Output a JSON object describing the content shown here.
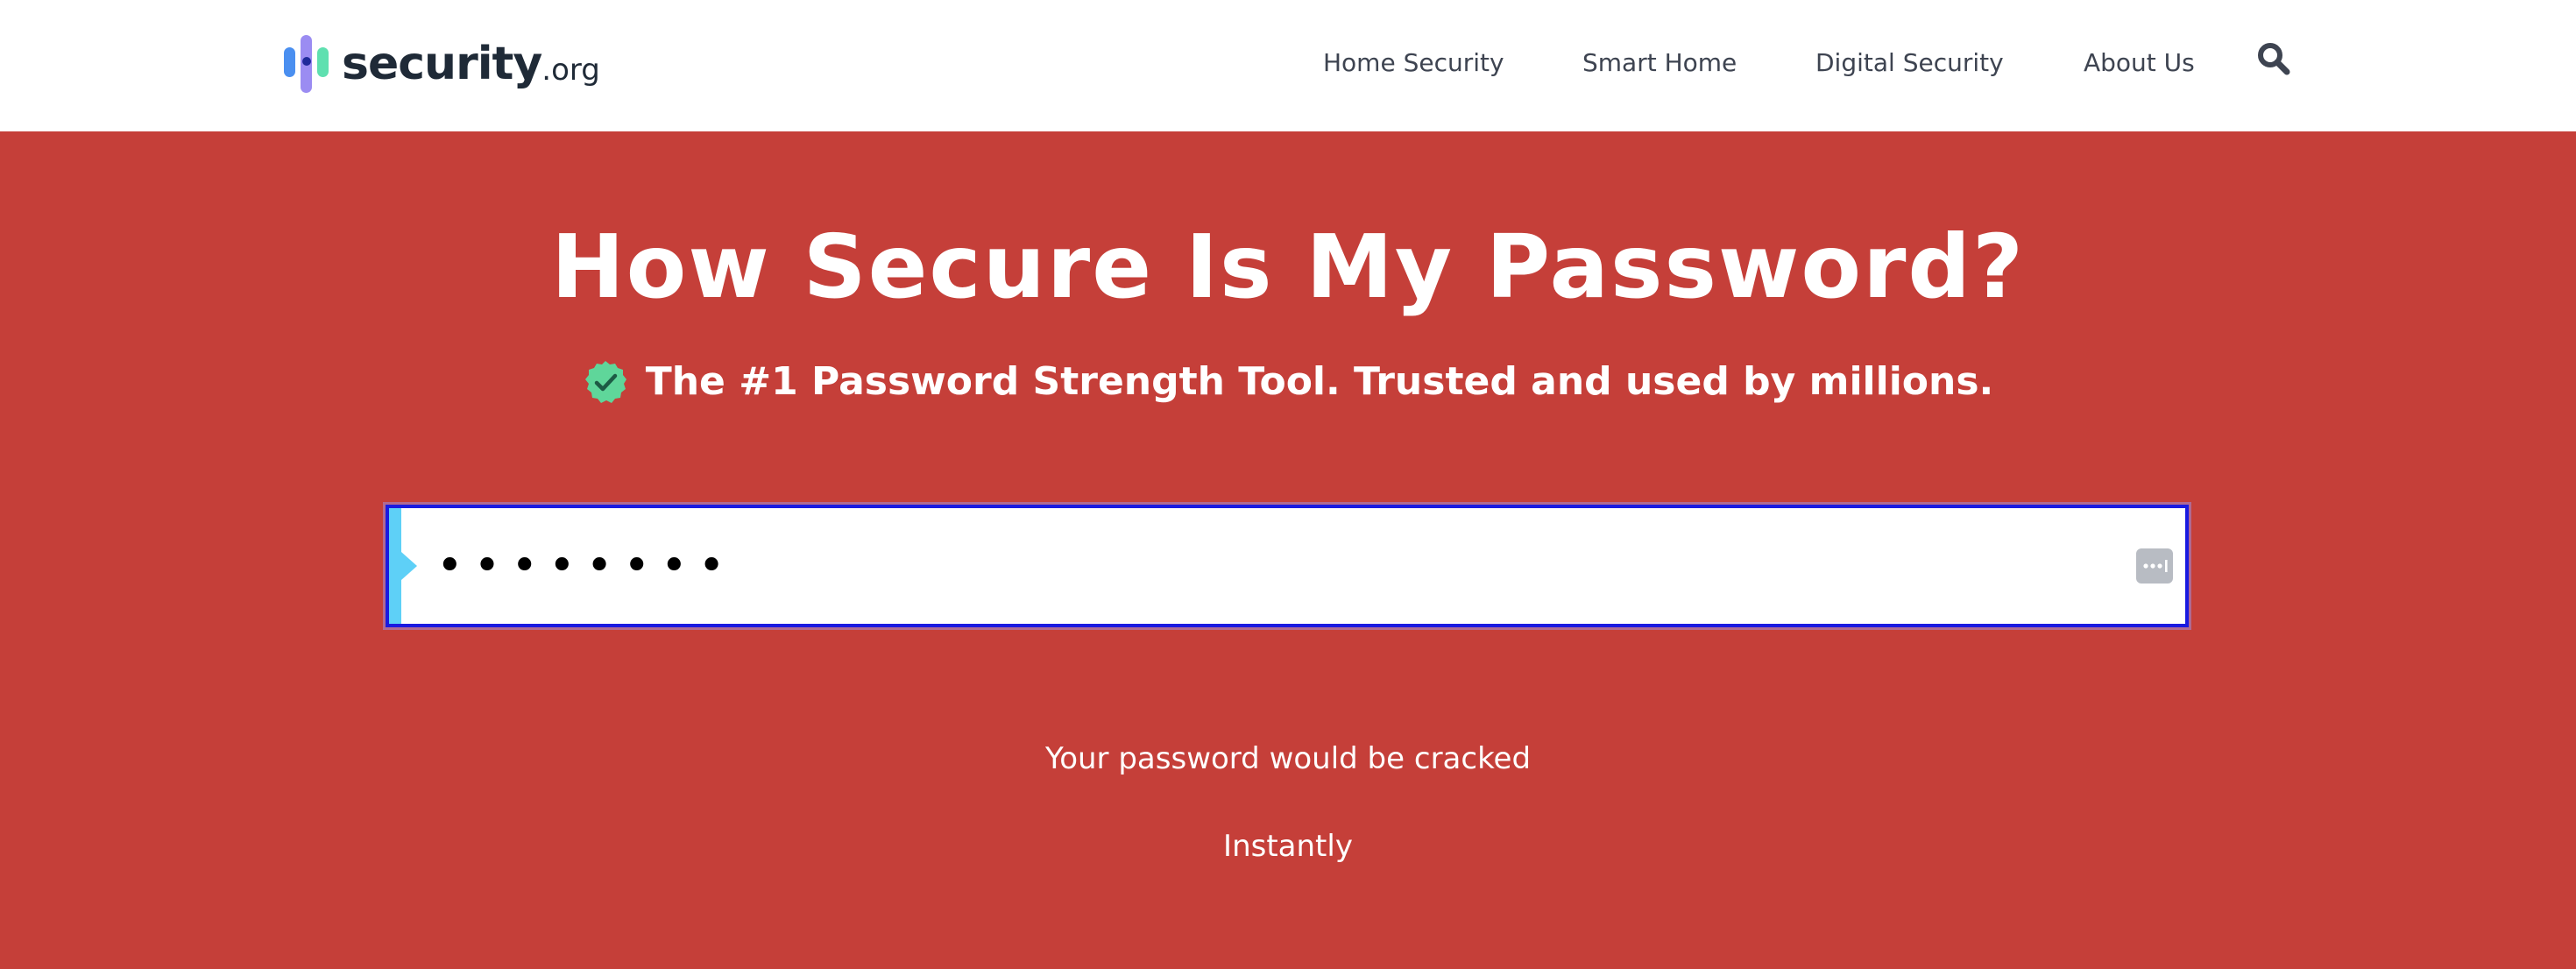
{
  "header": {
    "logo": {
      "word": "security",
      "tld": ".org",
      "icon": "logo-bars-icon"
    },
    "nav": [
      {
        "label": "Home Security"
      },
      {
        "label": "Smart Home"
      },
      {
        "label": "Digital Security"
      },
      {
        "label": "About Us"
      }
    ],
    "search_icon": "search-icon"
  },
  "hero": {
    "title": "How Secure Is My Password?",
    "subtitle": "The #1 Password Strength Tool. Trusted and used by millions.",
    "badge_icon": "verified-check-icon"
  },
  "password": {
    "value": "••••••••",
    "manager_icon": "password-manager-icon"
  },
  "result": {
    "line1": "Your password would be cracked",
    "line2": "Instantly"
  },
  "colors": {
    "hero_bg": "#c53f39",
    "header_bg": "#ffffff",
    "input_border": "#1a1ae0",
    "accent": "#5ed0f7",
    "badge": "#5fd69a",
    "nav_text": "#3e4451"
  }
}
